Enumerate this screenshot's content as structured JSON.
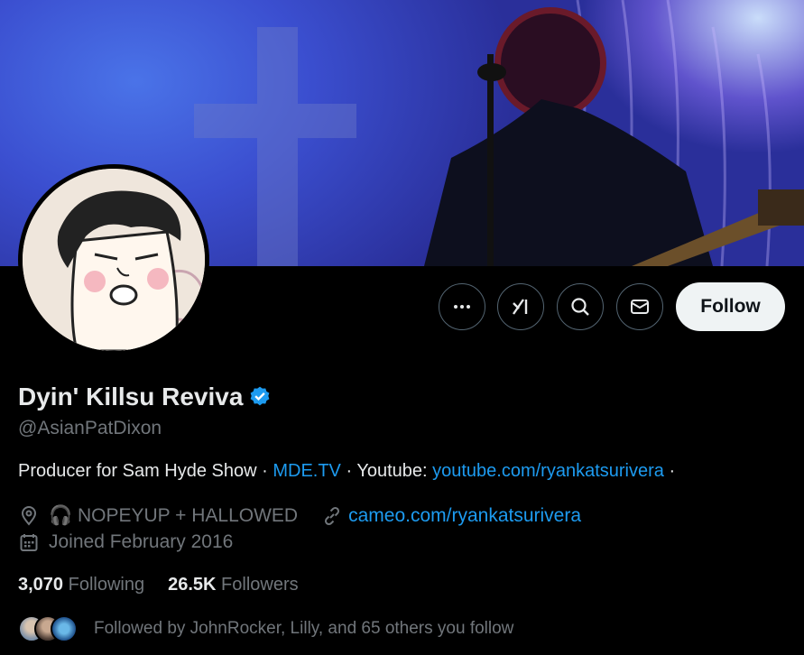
{
  "profile": {
    "name": "Dyin' Killsu Reviva",
    "handle": "@AsianPatDixon",
    "bio_prefix": "Producer for Sam Hyde Show · ",
    "bio_link1": "MDE.TV",
    "bio_mid": " · Youtube: ",
    "bio_link2": "youtube.com/ryankatsurivera",
    "bio_suffix": " ·",
    "location": "🎧 NOPEYUP + HALLOWED",
    "website": "cameo.com/ryankatsurivera",
    "joined": "Joined February 2016"
  },
  "actions": {
    "follow_label": "Follow",
    "more_icon": "more-icon",
    "grok_icon": "grok-icon",
    "search_icon": "search-icon",
    "message_icon": "mail-icon"
  },
  "stats": {
    "following_count": "3,070",
    "following_label": "Following",
    "followers_count": "26.5K",
    "followers_label": "Followers"
  },
  "followed_by": "Followed by JohnRocker, Lilly, and 65 others you follow",
  "colors": {
    "accent": "#1d9bf0",
    "muted": "#71767b",
    "text": "#e7e9ea",
    "background": "#000000",
    "follow_bg": "#eff3f4"
  }
}
